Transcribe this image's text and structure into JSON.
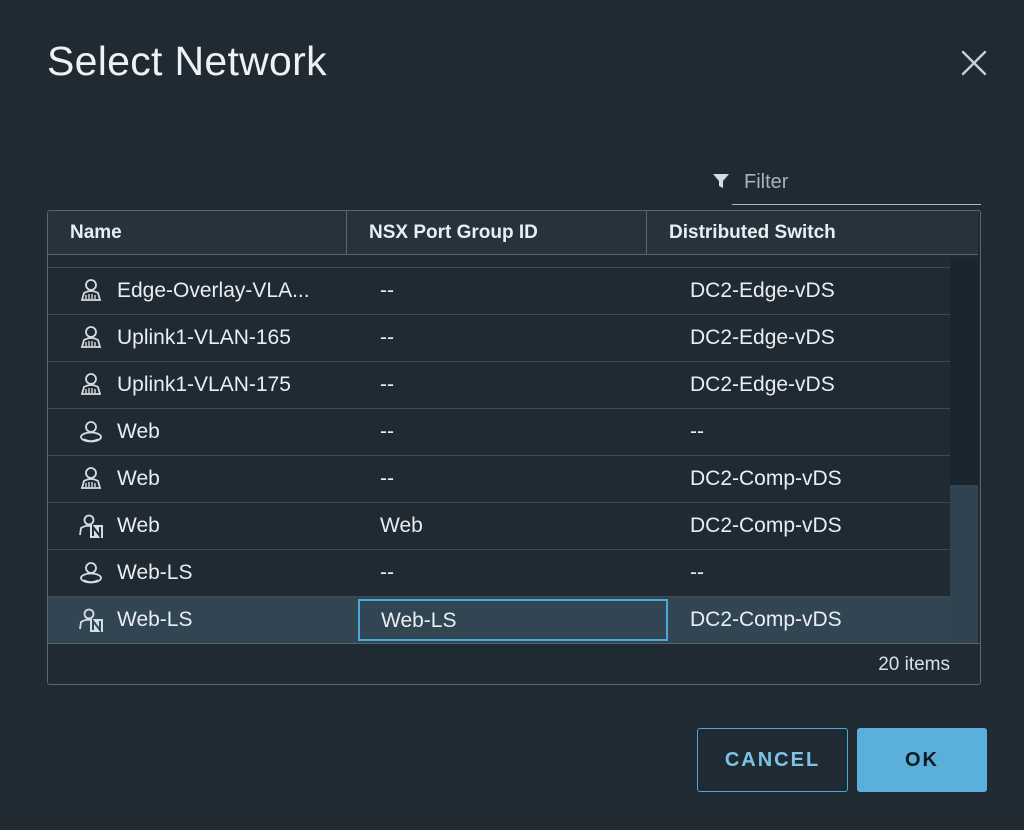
{
  "dialog": {
    "title": "Select Network",
    "close_icon": "close-icon"
  },
  "filter": {
    "placeholder": "Filter",
    "value": "",
    "icon": "filter-funnel-icon"
  },
  "table": {
    "columns": [
      "Name",
      "NSX Port Group ID",
      "Distributed Switch"
    ],
    "rows": [
      {
        "icon": "distributed-portgroup-icon",
        "name": "Edge-Overlay-VLA...",
        "port_group_id": "--",
        "switch": "DC2-Edge-vDS"
      },
      {
        "icon": "distributed-portgroup-icon",
        "name": "Uplink1-VLAN-165",
        "port_group_id": "--",
        "switch": "DC2-Edge-vDS"
      },
      {
        "icon": "distributed-portgroup-icon",
        "name": "Uplink1-VLAN-175",
        "port_group_id": "--",
        "switch": "DC2-Edge-vDS"
      },
      {
        "icon": "standard-network-icon",
        "name": "Web",
        "port_group_id": "--",
        "switch": "--"
      },
      {
        "icon": "distributed-portgroup-icon",
        "name": "Web",
        "port_group_id": "--",
        "switch": "DC2-Comp-vDS"
      },
      {
        "icon": "nsx-segment-icon",
        "name": "Web",
        "port_group_id": "Web",
        "switch": "DC2-Comp-vDS"
      },
      {
        "icon": "standard-network-icon",
        "name": "Web-LS",
        "port_group_id": "--",
        "switch": "--"
      },
      {
        "icon": "nsx-segment-icon",
        "name": "Web-LS",
        "port_group_id": "Web-LS",
        "switch": "DC2-Comp-vDS",
        "selected": true
      }
    ],
    "item_count": "20 items"
  },
  "buttons": {
    "cancel": "CANCEL",
    "ok": "OK"
  },
  "colors": {
    "background": "#1f2a33",
    "accent": "#49a9da",
    "primary_button": "#5bb0db",
    "selected_row": "#324553"
  }
}
